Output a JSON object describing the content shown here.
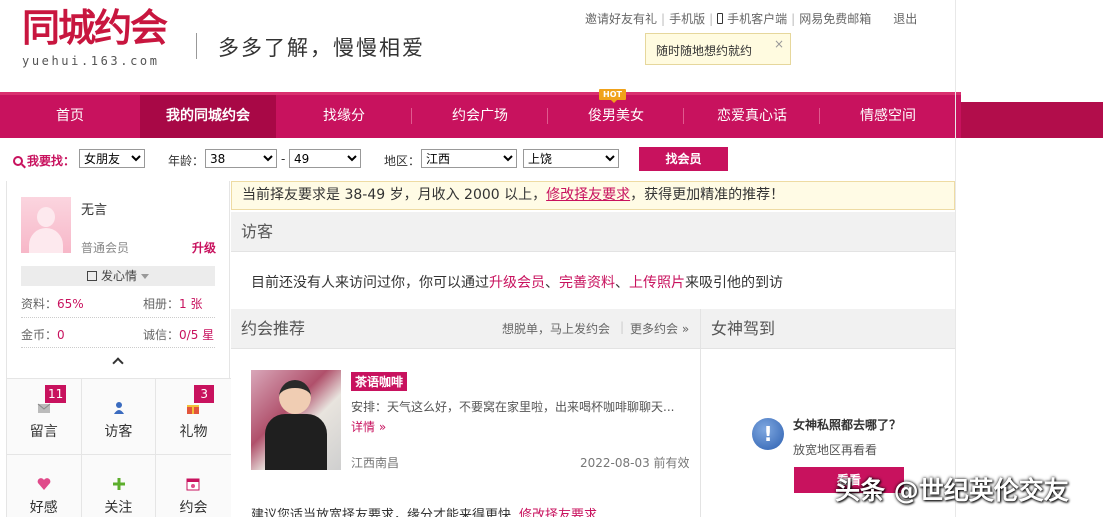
{
  "header": {
    "logo_text": "同城约会",
    "logo_domain": "yuehui.163.com",
    "slogan": "多多了解，慢慢相爱",
    "top_links": [
      "邀请好友有礼",
      "手机版",
      "手机客户端",
      "网易免费邮箱"
    ],
    "logout": "退出",
    "tip_text": "随时随地想约就约",
    "tip_close": "×"
  },
  "nav": {
    "items": [
      "首页",
      "我的同城约会",
      "找缘分",
      "约会广场",
      "俊男美女",
      "恋爱真心话",
      "情感空间"
    ],
    "active_index": 1,
    "hot_badge": "HOT"
  },
  "search": {
    "label": "我要找：",
    "gender": "女朋友",
    "age_label": "年龄：",
    "age_min": "38",
    "age_sep": "-",
    "age_max": "49",
    "region_label": "地区：",
    "province": "江西",
    "city": "上饶",
    "button": "找会员"
  },
  "profile": {
    "name": "无言",
    "level": "普通会员",
    "upgrade": "升级",
    "mood_button": "发心情",
    "data_label": "资料：",
    "data_value": "65%",
    "album_label": "相册：",
    "album_value": "1 张",
    "coins_label": "金币：",
    "coins_value": "0",
    "credit_label": "诚信：",
    "credit_value": "0/5 星"
  },
  "quick": [
    {
      "label": "留言",
      "icon": "envelope-icon",
      "badge": "11"
    },
    {
      "label": "访客",
      "icon": "person-icon",
      "badge": ""
    },
    {
      "label": "礼物",
      "icon": "gift-icon",
      "badge": "3"
    },
    {
      "label": "好感",
      "icon": "heart-icon",
      "badge": ""
    },
    {
      "label": "关注",
      "icon": "plus-icon",
      "badge": ""
    },
    {
      "label": "约会",
      "icon": "calendar-icon",
      "badge": ""
    }
  ],
  "notice": {
    "text_before": "当前择友要求是 38-49 岁，月收入 2000 以上，",
    "link": "修改择友要求",
    "text_after": "，获得更加精准的推荐！"
  },
  "visitors": {
    "title": "访客",
    "text_prefix": "目前还没有人来访问过你，你可以通过",
    "link1": "升级会员",
    "sep1": "、",
    "link2": "完善资料",
    "sep2": "、",
    "link3": "上传照片",
    "text_suffix": "来吸引他的到访"
  },
  "dating": {
    "title": "约会推荐",
    "link_post": "想脱单，马上发约会",
    "link_more": "更多约会 »",
    "item": {
      "title": "茶语咖啡",
      "desc": "安排：天气这么好，不要窝在家里啦，出来喝杯咖啡聊聊天...",
      "more": "详情 »",
      "location": "江西南昌",
      "date": "2022-08-03 前有效"
    },
    "advice_text": "建议您适当放宽择友要求，缘分才能来得更快",
    "advice_link": "修改择友要求"
  },
  "goddess": {
    "title": "女神驾到",
    "question": "女神私照都去哪了？",
    "suggest": "放宽地区再看看",
    "button": "看看"
  },
  "watermark": "头条 @世纪英伦交友",
  "colors": {
    "brand": "#c8125e",
    "nav_active": "#a80846",
    "notice_bg": "#fffbe5"
  }
}
